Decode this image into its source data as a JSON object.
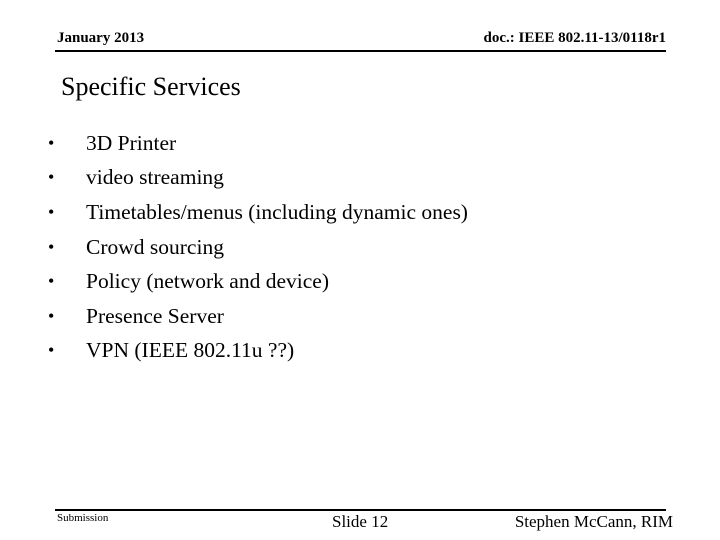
{
  "header": {
    "date": "January 2013",
    "doc_id": "doc.: IEEE 802.11-13/0118r1"
  },
  "slide": {
    "title": "Specific Services",
    "bullet_glyph": "•",
    "bullets": [
      "3D Printer",
      "video streaming",
      "Timetables/menus (including dynamic ones)",
      "Crowd sourcing",
      "Policy (network and device)",
      "Presence Server",
      "VPN (IEEE 802.11u ??)"
    ]
  },
  "footer": {
    "left": "Submission",
    "center": "Slide 12",
    "right": "Stephen McCann, RIM"
  }
}
